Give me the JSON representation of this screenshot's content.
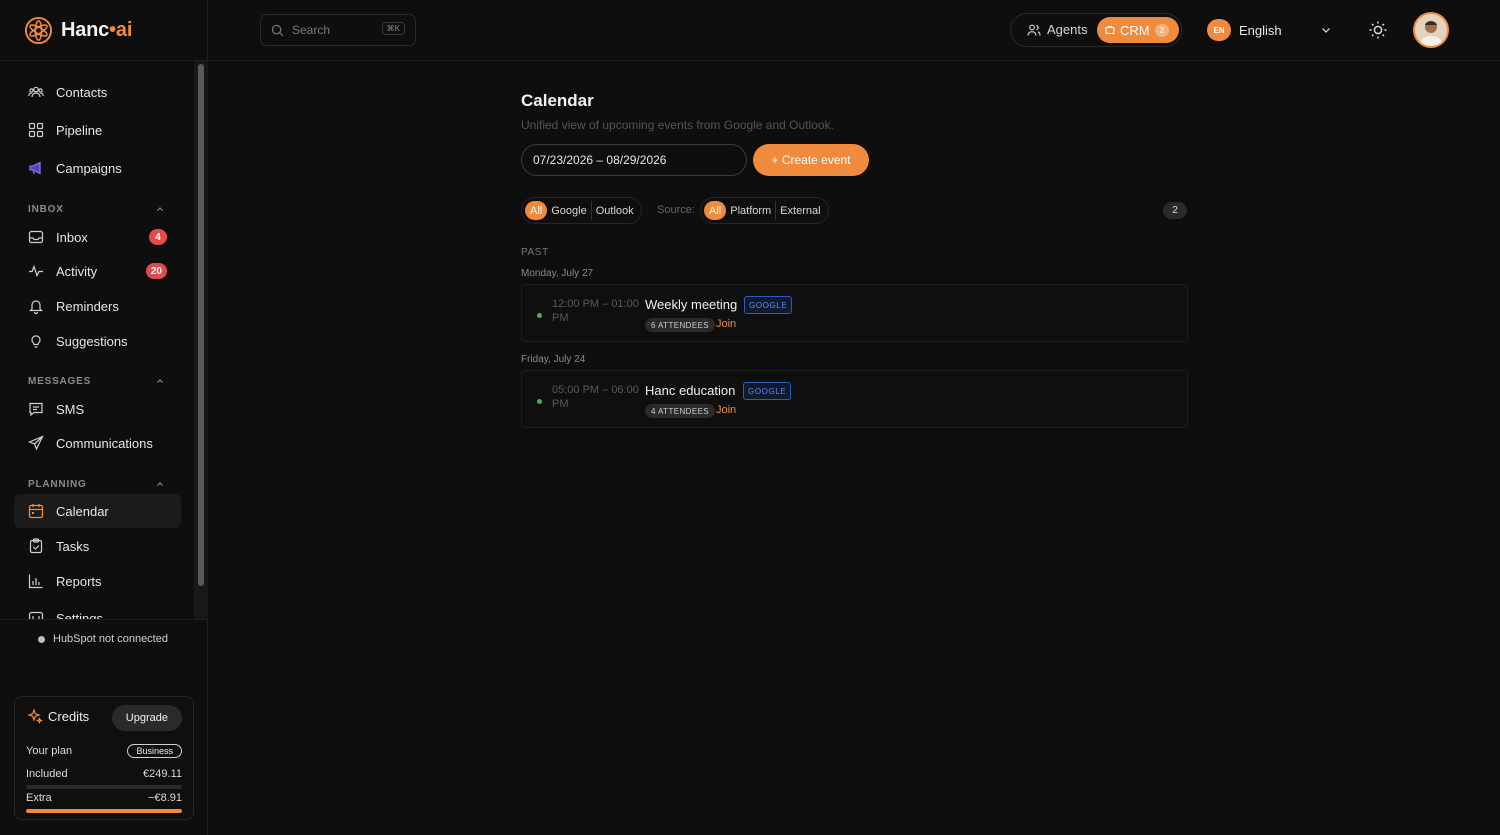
{
  "brand": {
    "name_main": "Hanc",
    "name_dot": "•",
    "name_suffix": "ai"
  },
  "search": {
    "placeholder": "Search",
    "shortcut": "⌘K"
  },
  "topbar": {
    "agents_label": "Agents",
    "crm_label": "CRM",
    "crm_count": "2",
    "language_code": "EN",
    "language_label": "English"
  },
  "sidebar": {
    "items_top": [
      {
        "label": "Contacts",
        "icon": "contacts-icon"
      },
      {
        "label": "Pipeline",
        "icon": "pipeline-icon"
      },
      {
        "label": "Campaigns",
        "icon": "megaphone-icon"
      }
    ],
    "inbox_section": "INBOX",
    "inbox_items": [
      {
        "label": "Inbox",
        "badge": "4"
      },
      {
        "label": "Activity",
        "badge": "20"
      },
      {
        "label": "Reminders"
      },
      {
        "label": "Suggestions"
      }
    ],
    "messages_section": "MESSAGES",
    "messages_items": [
      {
        "label": "SMS"
      },
      {
        "label": "Communications"
      }
    ],
    "planning_section": "PLANNING",
    "planning_items": [
      {
        "label": "Calendar"
      },
      {
        "label": "Tasks"
      },
      {
        "label": "Reports"
      },
      {
        "label": "Settings"
      }
    ],
    "hubspot_status": "HubSpot not connected"
  },
  "credits": {
    "title": "Credits",
    "upgrade_label": "Upgrade",
    "plan_label": "Your plan",
    "plan_value": "Business",
    "included_label": "Included",
    "included_value": "€249.11",
    "extra_label": "Extra",
    "extra_value": "−€8.91",
    "extra_progress": 1.0,
    "included_progress": 0.0
  },
  "calendar": {
    "title": "Calendar",
    "subtitle": "Unified view of upcoming events from Google and Outlook.",
    "date_range": "07/23/2026 – 08/29/2026",
    "create_label": "+ Create event",
    "provider_filter": [
      "All",
      "Google",
      "Outlook"
    ],
    "source_label": "Source:",
    "source_filter": [
      "All",
      "Platform",
      "External"
    ],
    "count": "2",
    "group_label": "PAST",
    "days": [
      {
        "label": "Monday, July 27",
        "event": {
          "time": "12:00 PM – 01:00 PM",
          "title": "Weekly meeting",
          "source": "GOOGLE",
          "attendees": "6 ATTENDEES",
          "join": "Join"
        }
      },
      {
        "label": "Friday, July 24",
        "event": {
          "time": "05:00 PM – 06:00 PM",
          "title": "Hanc education",
          "source": "GOOGLE",
          "attendees": "4 ATTENDEES",
          "join": "Join"
        }
      }
    ]
  },
  "colors": {
    "accent": "#f08a3c",
    "danger": "#e24b4b",
    "google_blue": "#5b8cf0",
    "online": "#3bb55d"
  }
}
